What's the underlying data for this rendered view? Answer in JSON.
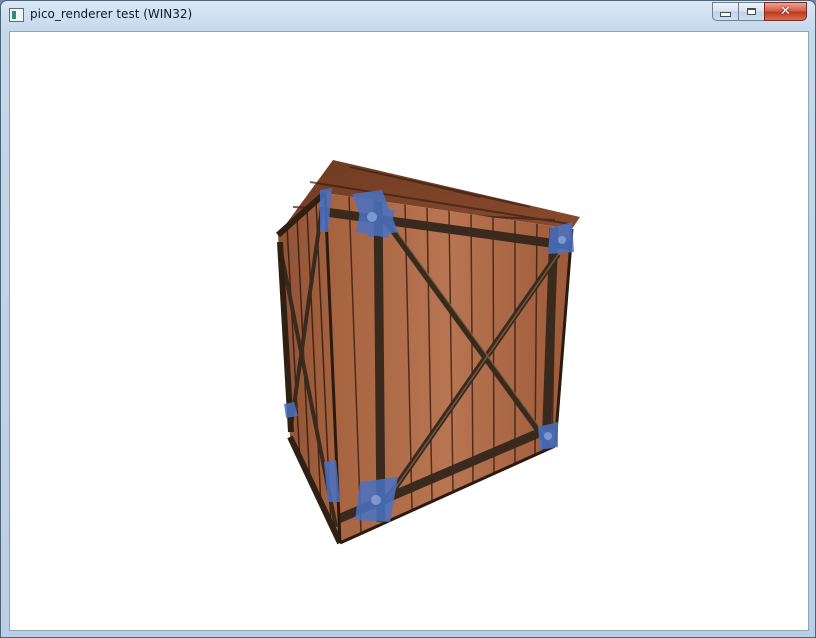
{
  "window": {
    "title": "pico_renderer test (WIN32)",
    "close_glyph": "✕"
  },
  "icons": {
    "app": "app-window-icon",
    "minimize": "minimize-icon",
    "maximize": "maximize-icon",
    "close": "close-icon"
  },
  "colors": {
    "client_background": "#ffffff",
    "wood_light": "#b4714f",
    "wood_dark": "#7a4128",
    "plank_line": "#2e180e",
    "brace": "#3a2a1e",
    "tape_blue": "#4a72c4",
    "close_button": "#c0391f"
  }
}
